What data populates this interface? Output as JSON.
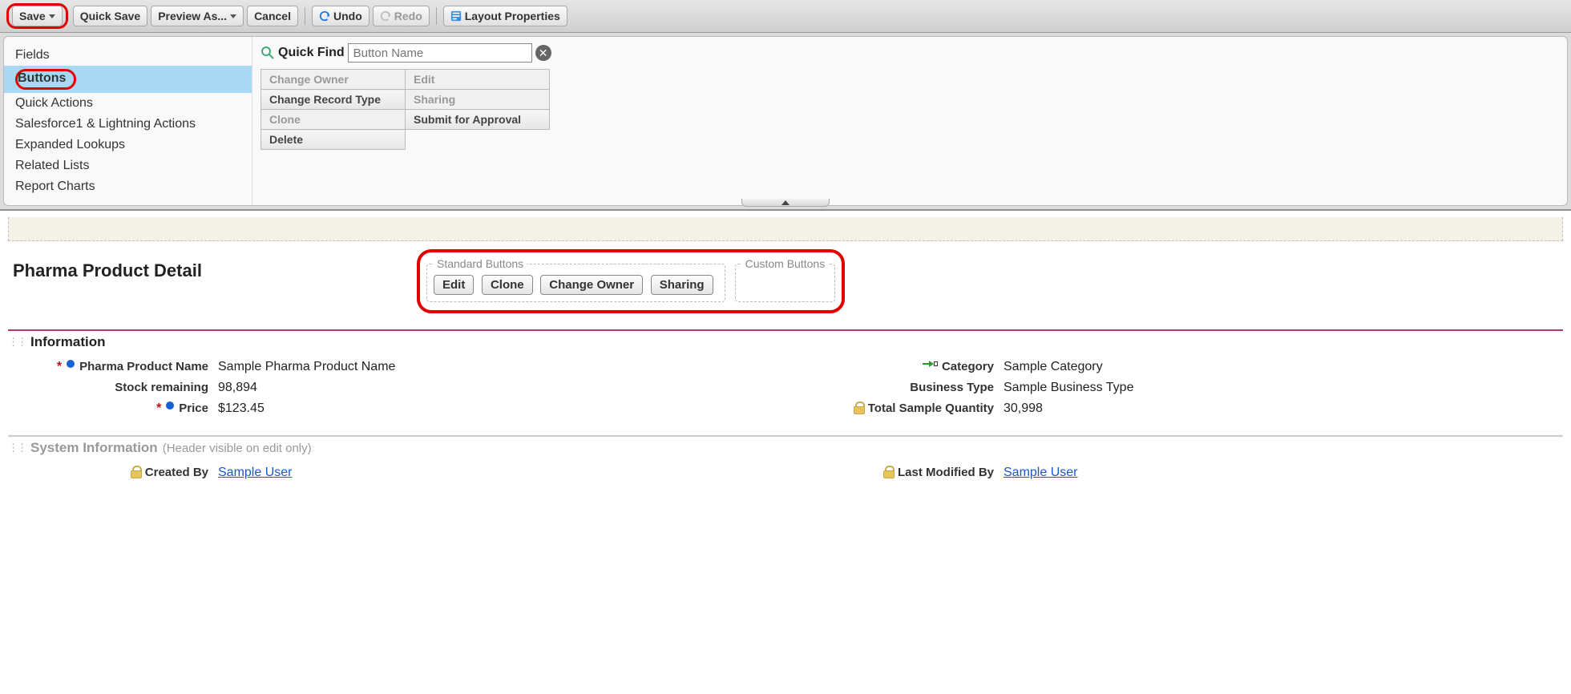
{
  "toolbar": {
    "save": "Save",
    "quick_save": "Quick Save",
    "preview_as": "Preview As...",
    "cancel": "Cancel",
    "undo": "Undo",
    "redo": "Redo",
    "layout_props": "Layout Properties"
  },
  "palette": {
    "categories": {
      "fields": "Fields",
      "buttons": "Buttons",
      "quick_actions": "Quick Actions",
      "sf1_actions": "Salesforce1 & Lightning Actions",
      "expanded_lookups": "Expanded Lookups",
      "related_lists": "Related Lists",
      "report_charts": "Report Charts"
    },
    "quick_find_label": "Quick Find",
    "quick_find_placeholder": "Button Name",
    "buttons": {
      "change_owner": "Change Owner",
      "edit": "Edit",
      "change_record_type": "Change Record Type",
      "sharing": "Sharing",
      "clone": "Clone",
      "submit_approval": "Submit for Approval",
      "delete": "Delete"
    }
  },
  "layout": {
    "page_title": "Pharma Product Detail",
    "standard_buttons_legend": "Standard Buttons",
    "custom_buttons_legend": "Custom Buttons",
    "std_btns": {
      "edit": "Edit",
      "clone": "Clone",
      "change_owner": "Change Owner",
      "sharing": "Sharing"
    },
    "sections": {
      "info": {
        "title": "Information",
        "left": {
          "name_label": "Pharma Product Name",
          "name_value": "Sample Pharma Product Name",
          "stock_label": "Stock remaining",
          "stock_value": "98,894",
          "price_label": "Price",
          "price_value": "$123.45"
        },
        "right": {
          "category_label": "Category",
          "category_value": "Sample Category",
          "biztype_label": "Business Type",
          "biztype_value": "Sample Business Type",
          "total_sample_label": "Total Sample Quantity",
          "total_sample_value": "30,998"
        }
      },
      "sysinfo": {
        "title": "System Information",
        "note": "(Header visible on edit only)",
        "created_by_label": "Created By",
        "created_by_value": "Sample User",
        "modified_by_label": "Last Modified By",
        "modified_by_value": "Sample User"
      }
    }
  }
}
